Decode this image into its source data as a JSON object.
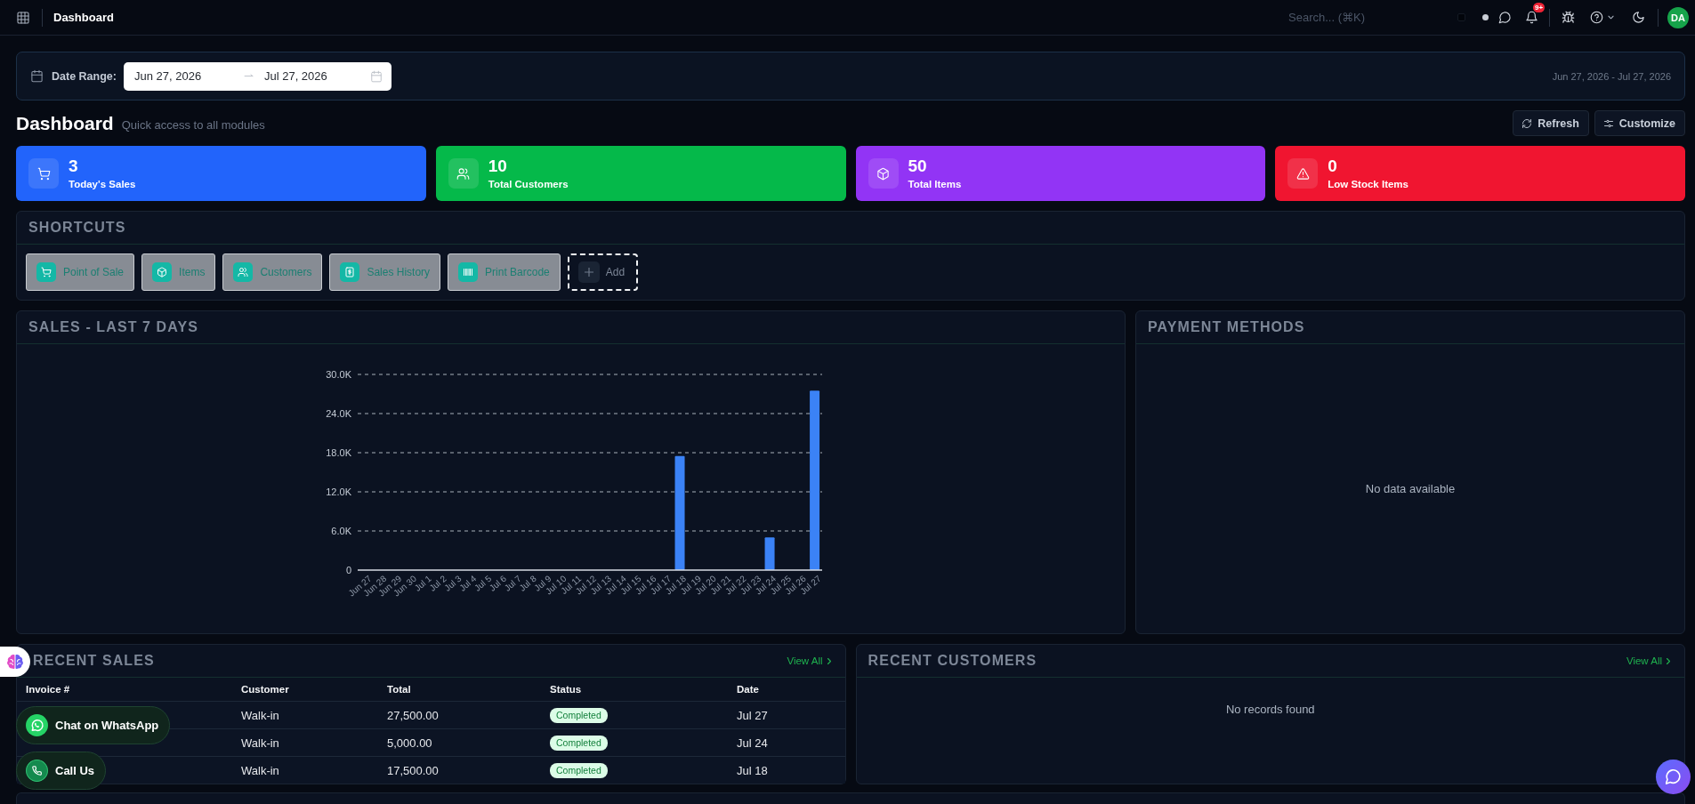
{
  "header": {
    "title": "Dashboard",
    "search": {
      "placeholder": "Search... (⌘K)"
    },
    "notification_badge": "9+",
    "avatar": "DA"
  },
  "date_range": {
    "label": "Date Range:",
    "start": "Jun 27, 2026",
    "end": "Jul 27, 2026",
    "summary": "Jun 27, 2026 - Jul 27, 2026"
  },
  "page": {
    "title": "Dashboard",
    "subtitle": "Quick access to all modules",
    "buttons": [
      "Refresh",
      "Customize"
    ]
  },
  "stats": [
    {
      "value": "3",
      "label": "Today's Sales",
      "color": "#2264fb"
    },
    {
      "value": "10",
      "label": "Total Customers",
      "color": "#05b94a"
    },
    {
      "value": "50",
      "label": "Total Items",
      "color": "#9234f5"
    },
    {
      "value": "0",
      "label": "Low Stock Items",
      "color": "#f01530"
    }
  ],
  "shortcuts": {
    "title": "SHORTCUTS",
    "items": [
      "Point of Sale",
      "Items",
      "Customers",
      "Sales History",
      "Print Barcode"
    ],
    "add_label": "Add"
  },
  "sales_chart": {
    "title": "SALES - LAST 7 DAYS",
    "chart_data": {
      "type": "bar",
      "categories": [
        "Jun 27",
        "Jun 28",
        "Jun 29",
        "Jun 30",
        "Jul 1",
        "Jul 2",
        "Jul 3",
        "Jul 4",
        "Jul 5",
        "Jul 6",
        "Jul 7",
        "Jul 8",
        "Jul 9",
        "Jul 10",
        "Jul 11",
        "Jul 12",
        "Jul 13",
        "Jul 14",
        "Jul 15",
        "Jul 16",
        "Jul 17",
        "Jul 18",
        "Jul 19",
        "Jul 20",
        "Jul 21",
        "Jul 22",
        "Jul 23",
        "Jul 24",
        "Jul 25",
        "Jul 26",
        "Jul 27"
      ],
      "values": [
        0,
        0,
        0,
        0,
        0,
        0,
        0,
        0,
        0,
        0,
        0,
        0,
        0,
        0,
        0,
        0,
        0,
        0,
        0,
        0,
        0,
        17500,
        0,
        0,
        0,
        0,
        0,
        5000,
        0,
        0,
        27500
      ],
      "ylim": [
        0,
        30000
      ],
      "yticks": [
        {
          "value": 0,
          "label": "0"
        },
        {
          "value": 6000,
          "label": "6.0K"
        },
        {
          "value": 12000,
          "label": "12.0K"
        },
        {
          "value": 18000,
          "label": "18.0K"
        },
        {
          "value": 24000,
          "label": "24.0K"
        },
        {
          "value": 30000,
          "label": "30.0K"
        }
      ],
      "grid": true
    }
  },
  "payment_methods": {
    "title": "PAYMENT METHODS",
    "empty_text": "No data available"
  },
  "recent_sales": {
    "title": "RECENT SALES",
    "link": "View All",
    "columns": [
      "Invoice #",
      "Customer",
      "Total",
      "Status",
      "Date"
    ],
    "rows": [
      {
        "customer": "Walk-in",
        "total": "27,500.00",
        "status": "Completed",
        "date": "Jul 27"
      },
      {
        "customer": "Walk-in",
        "total": "5,000.00",
        "status": "Completed",
        "date": "Jul 24"
      },
      {
        "customer": "Walk-in",
        "total": "17,500.00",
        "status": "Completed",
        "date": "Jul 18"
      }
    ]
  },
  "recent_customers": {
    "title": "RECENT CUSTOMERS",
    "link": "View All",
    "empty_text": "No records found"
  },
  "floating": {
    "whatsapp": "Chat on WhatsApp",
    "call": "Call Us"
  }
}
